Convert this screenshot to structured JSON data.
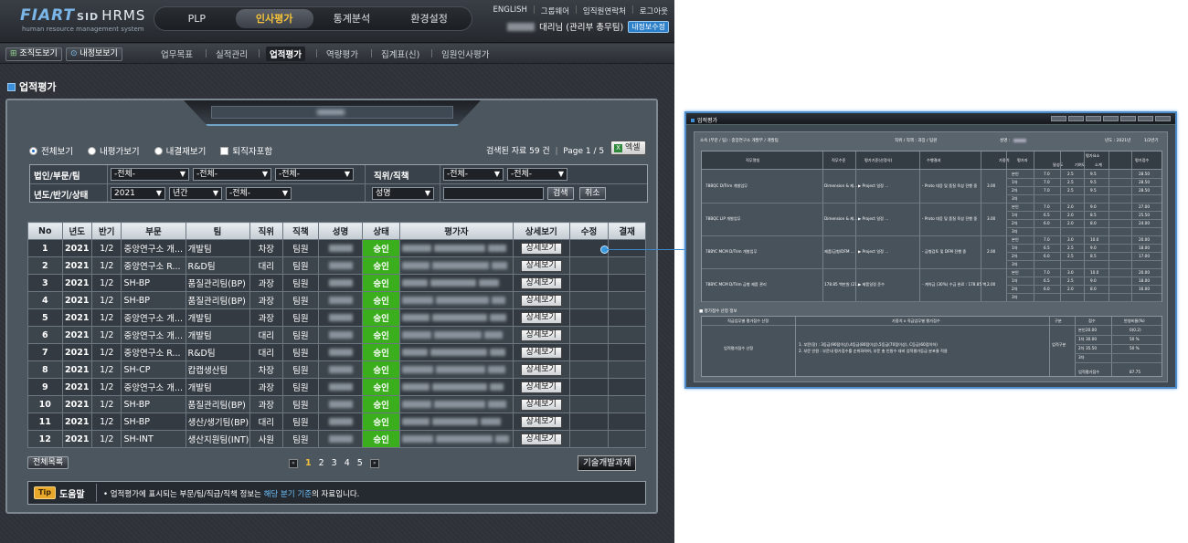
{
  "header": {
    "logo": "FIART",
    "logo_sid": "SID",
    "logo_hrms": "HRMS",
    "logo_sub": "human resource management system",
    "main_nav": [
      "PLP",
      "인사평가",
      "통계분석",
      "환경설정"
    ],
    "top_links": [
      "ENGLISH",
      "그룹웨어",
      "임직원연락처",
      "로그아웃"
    ],
    "user_label": "대리님 (관리부 총무팀)",
    "user_badge": "내정보수정"
  },
  "subnav": {
    "org_button": "조직도보기",
    "my_button": "내정보보기",
    "items": [
      "업무목표",
      "실적관리",
      "업적평가",
      "역량평가",
      "집계표(신)",
      "임원인사평가"
    ]
  },
  "page_title": "업적평가",
  "options": {
    "radios": [
      "전체보기",
      "내평가보기",
      "내결재보기"
    ],
    "checkbox": "퇴직자포함",
    "result_count": "검색된 자료 59 건",
    "page_info": "Page 1 / 5",
    "excel": "엑셀"
  },
  "filter": {
    "row1_label": "법인/부문/팀",
    "row1_selects": [
      "-전체-",
      "-전체-",
      "-전체-"
    ],
    "pos_label": "직위/직책",
    "pos_selects": [
      "-전체-",
      "-전체-"
    ],
    "row2_label": "년도/반기/상태",
    "year": "2021",
    "period": "년간",
    "state": "-전체-",
    "name_select": "성명",
    "search_btn": "검색",
    "cancel_btn": "취소"
  },
  "table": {
    "headers": [
      "No",
      "년도",
      "반기",
      "부문",
      "팀",
      "직위",
      "직책",
      "성명",
      "상태",
      "평가자",
      "상세보기",
      "수정",
      "결재"
    ],
    "detail_label": "상세보기",
    "rows": [
      {
        "no": "1",
        "year": "2021",
        "half": "1/2",
        "dept": "중앙연구소 개...",
        "team": "개발팀",
        "pos": "차장",
        "role": "팀원",
        "status": "승인"
      },
      {
        "no": "2",
        "year": "2021",
        "half": "1/2",
        "dept": "중앙연구소 R...",
        "team": "R&D팀",
        "pos": "대리",
        "role": "팀원",
        "status": "승인"
      },
      {
        "no": "3",
        "year": "2021",
        "half": "1/2",
        "dept": "SH-BP",
        "team": "품질관리팀(BP)",
        "pos": "과장",
        "role": "팀원",
        "status": "승인"
      },
      {
        "no": "4",
        "year": "2021",
        "half": "1/2",
        "dept": "SH-BP",
        "team": "품질관리팀(BP)",
        "pos": "과장",
        "role": "팀원",
        "status": "승인"
      },
      {
        "no": "5",
        "year": "2021",
        "half": "1/2",
        "dept": "중앙연구소 개...",
        "team": "개발팀",
        "pos": "과장",
        "role": "팀원",
        "status": "승인"
      },
      {
        "no": "6",
        "year": "2021",
        "half": "1/2",
        "dept": "중앙연구소 개...",
        "team": "개발팀",
        "pos": "대리",
        "role": "팀원",
        "status": "승인"
      },
      {
        "no": "7",
        "year": "2021",
        "half": "1/2",
        "dept": "중앙연구소 R...",
        "team": "R&D팀",
        "pos": "대리",
        "role": "팀원",
        "status": "승인"
      },
      {
        "no": "8",
        "year": "2021",
        "half": "1/2",
        "dept": "SH-CP",
        "team": "캅캡생산팀",
        "pos": "차장",
        "role": "팀원",
        "status": "승인"
      },
      {
        "no": "9",
        "year": "2021",
        "half": "1/2",
        "dept": "중앙연구소 개...",
        "team": "개발팀",
        "pos": "과장",
        "role": "팀원",
        "status": "승인"
      },
      {
        "no": "10",
        "year": "2021",
        "half": "1/2",
        "dept": "SH-BP",
        "team": "품질관리팀(BP)",
        "pos": "과장",
        "role": "팀원",
        "status": "승인"
      },
      {
        "no": "11",
        "year": "2021",
        "half": "1/2",
        "dept": "SH-BP",
        "team": "생산/생기팀(BP)",
        "pos": "대리",
        "role": "팀원",
        "status": "승인"
      },
      {
        "no": "12",
        "year": "2021",
        "half": "1/2",
        "dept": "SH-INT",
        "team": "생산지원팀(INT)",
        "pos": "사원",
        "role": "팀원",
        "status": "승인"
      }
    ]
  },
  "bottom": {
    "all_list": "전체목록",
    "pages": [
      "1",
      "2",
      "3",
      "4",
      "5"
    ],
    "current_page": "1",
    "prev": "«",
    "next": "»",
    "tech_button": "기술개발과제"
  },
  "tip": {
    "badge": "Tip",
    "label": "도움말",
    "text_a": "• 업적평가에 표시되는 부문/팀/직급/직책 정보는 ",
    "text_hl": "해당 분기 기준",
    "text_b": "의 자료입니다."
  },
  "popup": {
    "title": "업적평가",
    "info_org": "소속 (부문 / 팀) : 중앙연구소 개발부 / 개발팀",
    "info_pos": "직위 / 직책 : 과장 / 팀원",
    "info_name": "성명 :",
    "info_year": "년도 : 2021년",
    "info_half": "1/2반기",
    "t1_headers": [
      "직무명칭",
      "직무수준",
      "평가기준(산정식)",
      "수행결과",
      "가중치",
      "평가자",
      "평가요소",
      "평가점수"
    ],
    "t1_sub": [
      "달성도",
      "기여도",
      "소계"
    ],
    "evaluators": [
      "본인",
      "1차",
      "2차",
      "3차"
    ],
    "groups": [
      {
        "name": "78BQC D/Trim 개발업무",
        "level": "Dimension & 제...",
        "crit": "▶ Project 일정 ...",
        "result": "- Proto 대응 및 품질 육성 진행 중",
        "weight": "3.00",
        "scores": [
          [
            "7.0",
            "2.5",
            "9.5",
            "28.50"
          ],
          [
            "7.0",
            "2.5",
            "9.5",
            "28.50"
          ],
          [
            "7.0",
            "2.5",
            "9.5",
            "28.50"
          ],
          [
            "",
            "",
            "",
            ""
          ]
        ]
      },
      {
        "name": "78BQC LIP 개발업무",
        "level": "Dimension & 제...",
        "crit": "▶ Project 일정 ...",
        "result": "- Proto 대응 및 품질 육성 진행 중",
        "weight": "3.00",
        "scores": [
          [
            "7.0",
            "2.0",
            "9.0",
            "27.00"
          ],
          [
            "6.5",
            "2.0",
            "8.5",
            "25.50"
          ],
          [
            "6.0",
            "2.0",
            "8.0",
            "24.00"
          ],
          [
            "",
            "",
            "",
            ""
          ]
        ]
      },
      {
        "name": "78BYC MCM D/Trim 개발업무",
        "level": "제품/금형/DFM ...",
        "crit": "▶ Project 일정 ...",
        "result": "- 금형검토 및 DFM 진행 중",
        "weight": "2.00",
        "scores": [
          [
            "7.0",
            "3.0",
            "10.0",
            "20.00"
          ],
          [
            "6.5",
            "2.5",
            "9.0",
            "18.00"
          ],
          [
            "6.0",
            "2.5",
            "8.5",
            "17.00"
          ],
          [
            "",
            "",
            "",
            ""
          ]
        ]
      },
      {
        "name": "78BYC MCM D/Trim 금형 제품 관리",
        "level": "178.85 백만원 (21...",
        "crit": "▶ 제품일정 준수",
        "result": "- 계약금 (30%) 수금 완료 : 178.85 백...",
        "weight": "2.00",
        "scores": [
          [
            "7.0",
            "3.0",
            "10.0",
            "20.00"
          ],
          [
            "6.5",
            "2.5",
            "9.0",
            "18.00"
          ],
          [
            "6.0",
            "2.0",
            "8.0",
            "16.00"
          ],
          [
            "",
            "",
            "",
            ""
          ]
        ]
      }
    ],
    "sec2_title": "■ 평가점수 산정 정보",
    "t2_head1": "직급업무별 평가점수 산정",
    "t2_head2": "가중치 x 직급업무별 평가점수",
    "t2_head3": "구분",
    "t2_head4": "점수",
    "t2_head5": "반영비율(%)",
    "t2_rowlabel": "업적평가점수 산정",
    "t2_line1": "1. 부문(장) : 3등급(90점이상),4등급(80점이상),5등급(70점이상), C등급(60점이하)",
    "t2_line2": "2. 부문 인원 : 부문내 평가점수를 순위화하여, 부문 총 인원수 대비 업적평가등급 분포율 적용",
    "t2_group": "업적구분",
    "t2_rows": [
      [
        "본인",
        "20.00",
        "0(0.2)"
      ],
      [
        "1차",
        "30.00",
        "50 %"
      ],
      [
        "2차",
        "35.50",
        "50 %"
      ],
      [
        "3차",
        "",
        ""
      ]
    ],
    "t2_total_label": "업적평가점수",
    "t2_total": "87.75"
  }
}
